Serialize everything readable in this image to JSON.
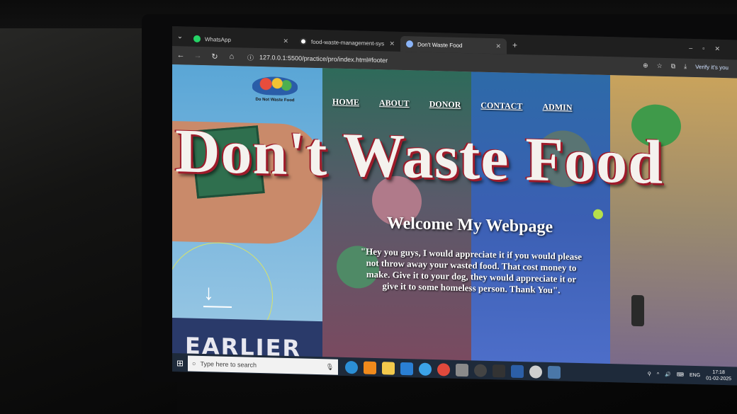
{
  "browser": {
    "tabs": [
      {
        "label": "WhatsApp",
        "icon": "whatsapp-icon"
      },
      {
        "label": "food-waste-management-sys",
        "icon": "github-icon"
      },
      {
        "label": "Don't Waste Food",
        "icon": "globe-icon"
      }
    ],
    "url": "127.0.0.1:5500/practice/pro/index.html#footer",
    "verify_label": "Verify it's you"
  },
  "site": {
    "logo_text": "Do Not Waste Food",
    "nav": [
      "HOME",
      "ABOUT",
      "DONOR",
      "CONTACT",
      "ADMIN"
    ],
    "hero_title": "Don't Waste Food",
    "welcome": "Welcome My Webpage",
    "quote": "\"Hey you guys, I would appreciate it if you would please not throw away your wasted food. That cost money to make. Give it to your dog, they would appreciate it or give it to some homeless person. Thank You\".",
    "earlier": "EARLIER"
  },
  "taskbar": {
    "search_placeholder": "Type here to search",
    "lang": "ENG",
    "time": "17:18",
    "date": "01-02-2025"
  },
  "colors": {
    "title_outline": "#9e1b2a",
    "taskbar_bg": "#1e2a3a"
  }
}
